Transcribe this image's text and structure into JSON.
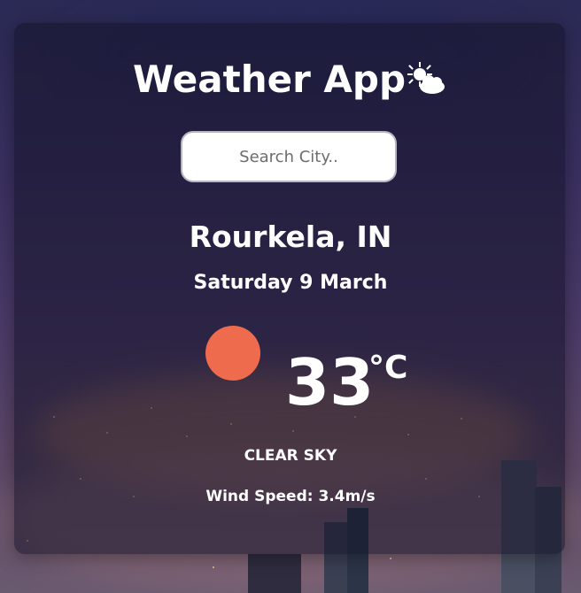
{
  "app": {
    "title": "Weather App",
    "title_icon": "sun-behind-cloud-icon"
  },
  "search": {
    "placeholder": "Search City..",
    "value": ""
  },
  "location": {
    "city": "Rourkela, IN",
    "date": "Saturday 9 March"
  },
  "weather": {
    "icon": "sun-icon",
    "icon_color": "#ee6c4d",
    "temperature": "33",
    "unit": "°C",
    "description": "CLEAR SKY",
    "wind": "Wind Speed: 3.4m/s"
  }
}
